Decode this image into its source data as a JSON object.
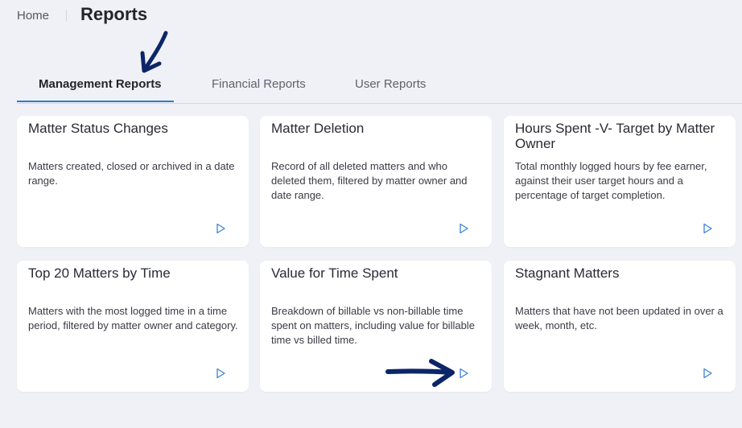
{
  "breadcrumb": {
    "home": "Home"
  },
  "page": {
    "title": "Reports"
  },
  "tabs": [
    {
      "label": "Management Reports",
      "active": true
    },
    {
      "label": "Financial Reports",
      "active": false
    },
    {
      "label": "User Reports",
      "active": false
    }
  ],
  "cards": [
    {
      "title": "Matter Status Changes",
      "description": "Matters created, closed or archived in a date range."
    },
    {
      "title": "Matter Deletion",
      "description": "Record of all deleted matters and who deleted them, filtered by matter owner and date range."
    },
    {
      "title": "Hours Spent -V- Target by Matter Owner",
      "description": "Total monthly logged hours by fee earner, against their user target hours and a percentage of target completion."
    },
    {
      "title": "Top 20 Matters by Time",
      "description": "Matters with the most logged time in a time period, filtered by matter owner and category."
    },
    {
      "title": "Value for Time Spent",
      "description": "Breakdown of billable vs non-billable time spent on matters, including value for billable time vs billed time."
    },
    {
      "title": "Stagnant Matters",
      "description": "Matters that have not been updated in over a week, month, etc."
    }
  ],
  "colors": {
    "accent": "#2e7ad1",
    "annotation_arrow": "#0b2568",
    "play_icon": "#3b82d6"
  },
  "icons": {
    "card_action": "play-icon"
  }
}
